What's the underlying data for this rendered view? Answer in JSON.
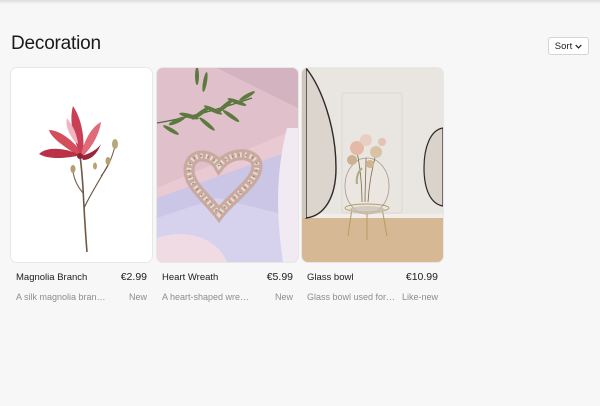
{
  "page": {
    "title": "Decoration"
  },
  "toolbar": {
    "sort_label": "Sort",
    "sort_icon": "chevron-down-icon"
  },
  "products": [
    {
      "name": "Magnolia Branch",
      "price": "€2.99",
      "description": "A silk magnolia branch",
      "condition": "New"
    },
    {
      "name": "Heart Wreath",
      "price": "€5.99",
      "description": "A heart-shaped wreath",
      "condition": "New"
    },
    {
      "name": "Glass bowl",
      "price": "€10.99",
      "description": "Glass bowl used for decoration",
      "condition": "Like-new"
    }
  ]
}
